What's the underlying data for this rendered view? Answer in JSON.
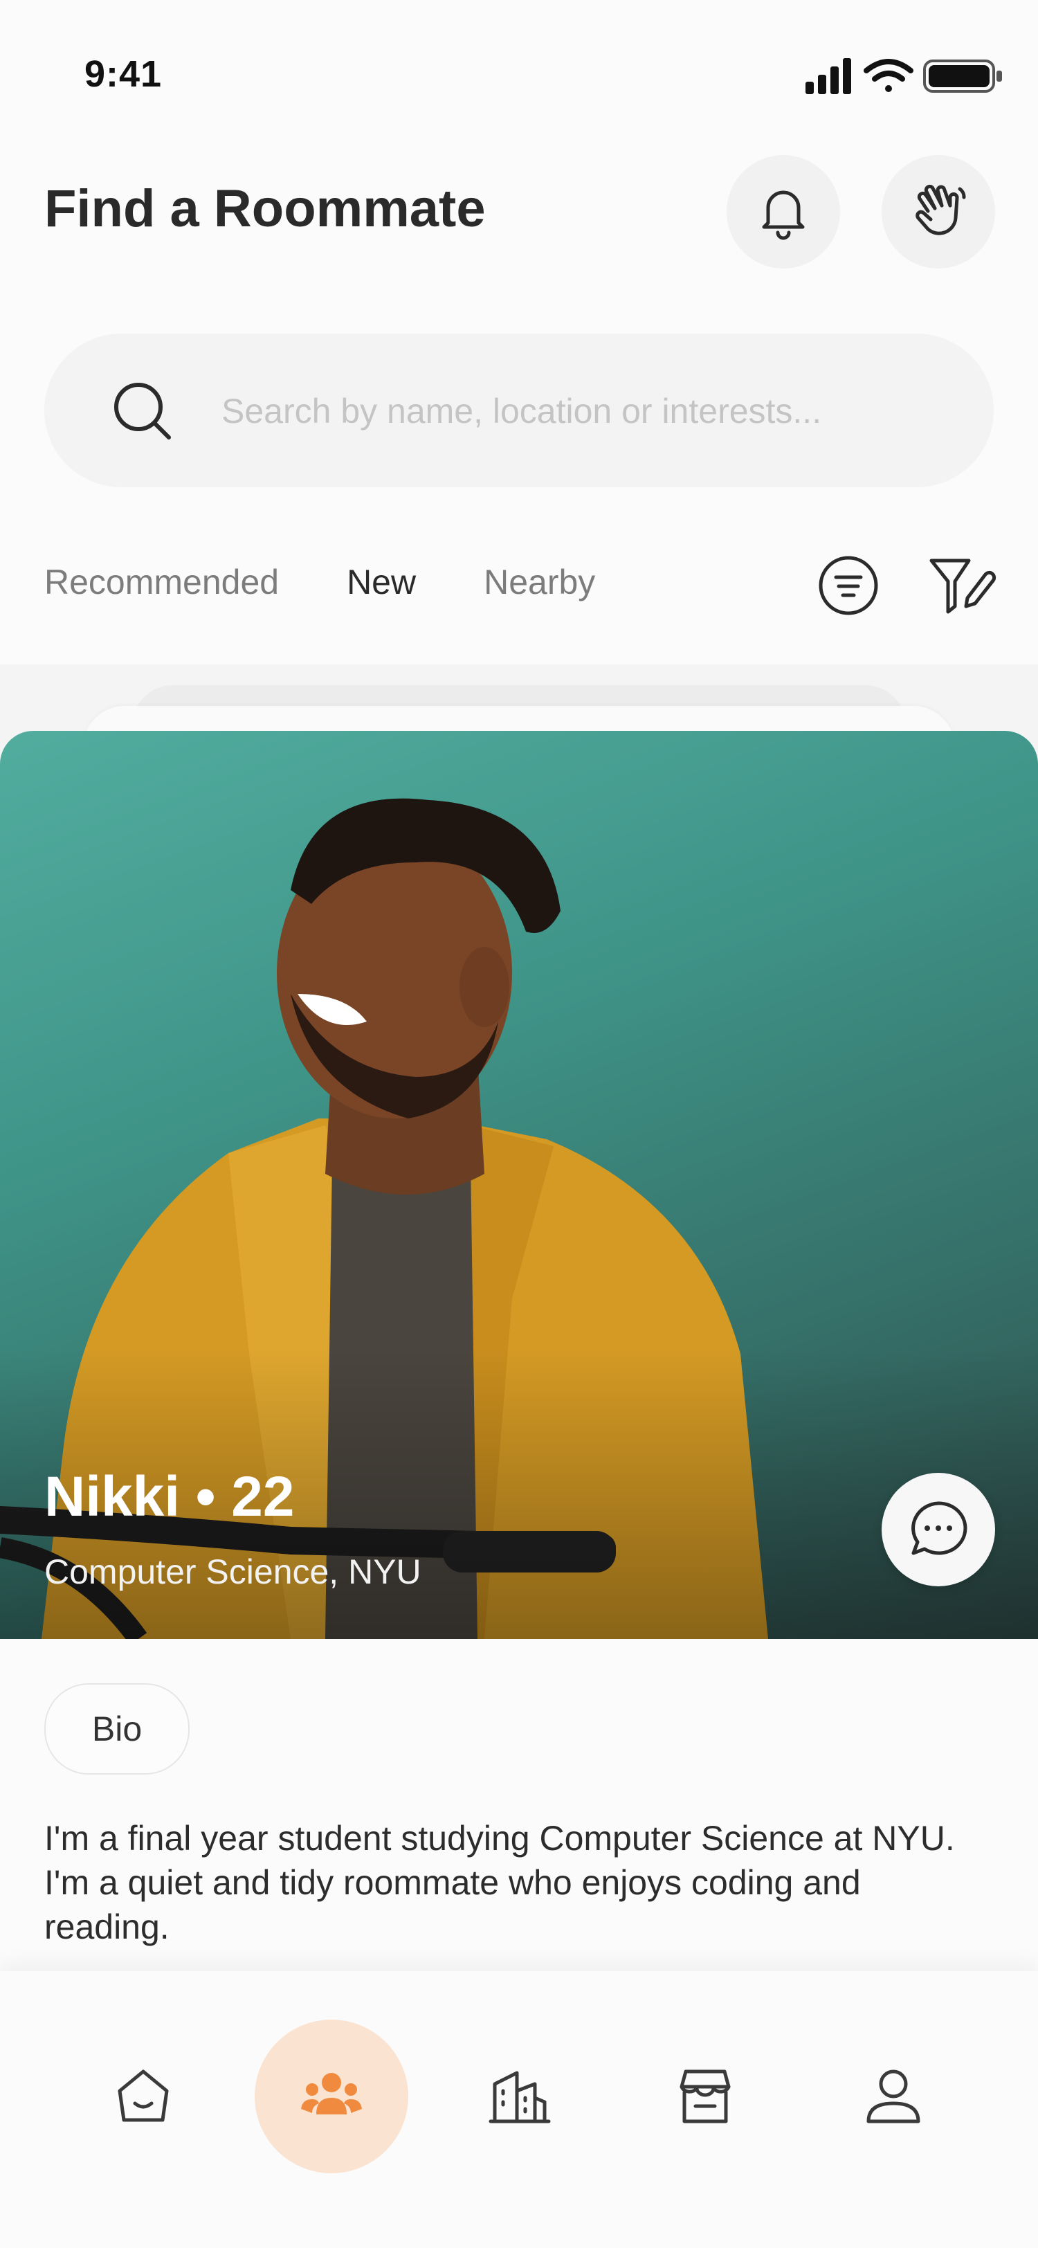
{
  "status_bar": {
    "time": "9:41"
  },
  "header": {
    "title": "Find a Roommate"
  },
  "search": {
    "placeholder": "Search by name, location or interests..."
  },
  "tabs": [
    {
      "label": "Recommended",
      "active": false
    },
    {
      "label": "New",
      "active": true
    },
    {
      "label": "Nearby",
      "active": false
    }
  ],
  "profile": {
    "name_line": "Nikki • 22",
    "subtitle": "Computer Science, NYU",
    "bio_label": "Bio",
    "bio_text": "I'm a final year student studying Computer Science at NYU. I'm a quiet and tidy roommate who enjoys coding and reading."
  },
  "bottom_nav": {
    "items": [
      {
        "icon": "home-icon",
        "active": false
      },
      {
        "icon": "roommates-icon",
        "active": true
      },
      {
        "icon": "buildings-icon",
        "active": false
      },
      {
        "icon": "marketplace-icon",
        "active": false
      },
      {
        "icon": "profile-icon",
        "active": false
      }
    ]
  },
  "colors": {
    "accent": "#f08a3e",
    "accent_soft": "#fbe3d1",
    "photo_bg": "#3f9488"
  }
}
